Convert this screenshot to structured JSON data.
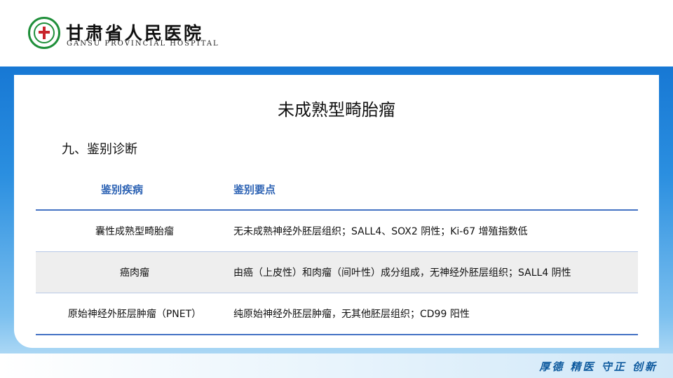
{
  "header": {
    "hospital_name_cn": "甘肃省人民医院",
    "hospital_name_en": "GANSU PROVINCIAL HOSPITAL"
  },
  "slide": {
    "title": "未成熟型畸胎瘤",
    "section": "九、鉴别诊断"
  },
  "table": {
    "headers": [
      "鉴别疾病",
      "鉴别要点"
    ],
    "rows": [
      {
        "disease": "囊性成熟型畸胎瘤",
        "points": "无未成熟神经外胚层组织；SALL4、SOX2 阴性；Ki-67 增殖指数低"
      },
      {
        "disease": "癌肉瘤",
        "points": "由癌（上皮性）和肉瘤（间叶性）成分组成，无神经外胚层组织；SALL4 阴性"
      },
      {
        "disease": "原始神经外胚层肿瘤（PNET）",
        "points": "纯原始神经外胚层肿瘤，无其他胚层组织；CD99 阳性"
      }
    ]
  },
  "footer": {
    "slogan": "厚德  精医  守正  创新"
  },
  "colors": {
    "accent_blue": "#1778d4",
    "header_text_blue": "#2d63b4",
    "logo_green": "#1f8f3a",
    "logo_red": "#c8242b"
  },
  "icons": {
    "logo": "hospital-emblem-icon"
  }
}
